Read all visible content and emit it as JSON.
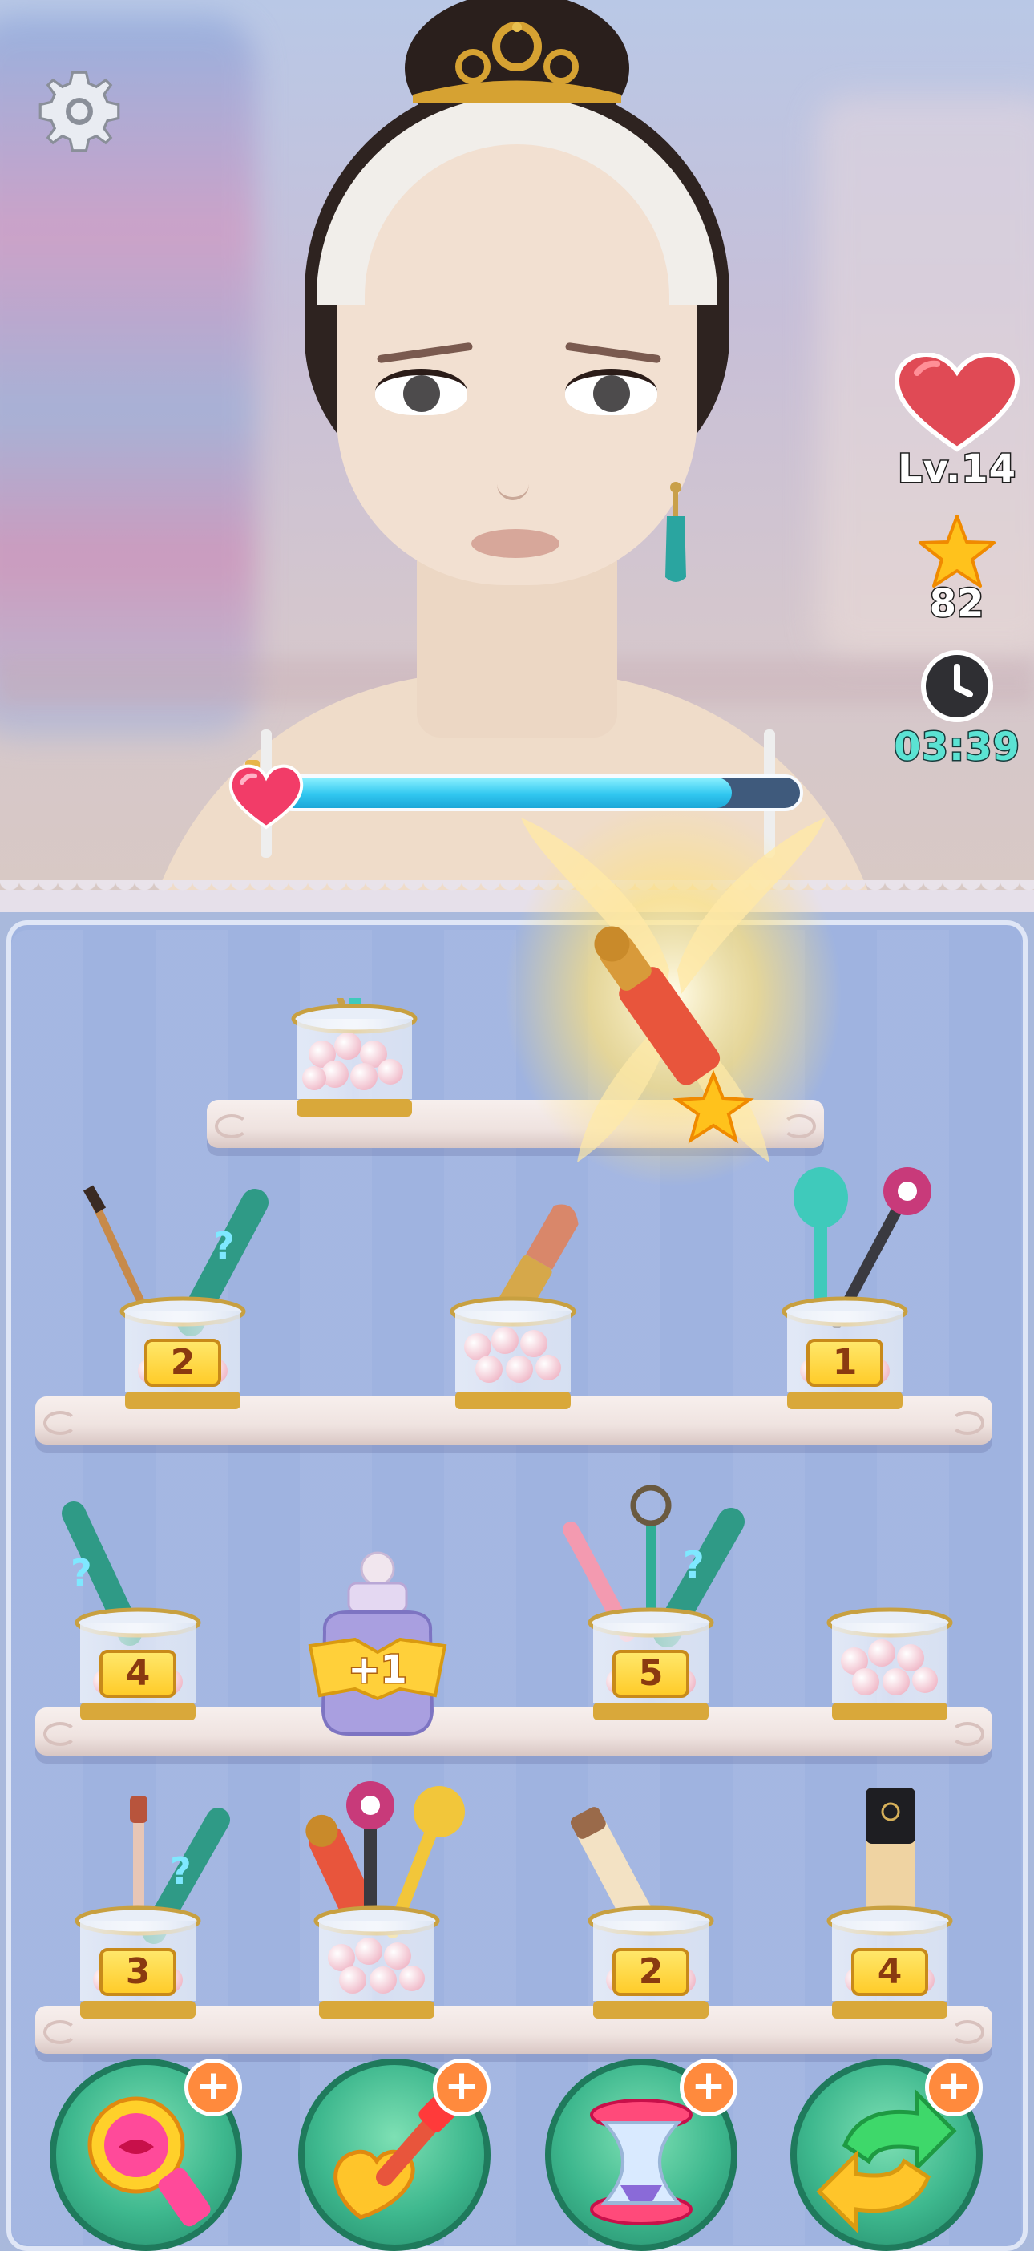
{
  "hud": {
    "level_label": "Lv.14",
    "stars": "82",
    "timer": "03:39",
    "progress_fraction": 0.87
  },
  "board": {
    "cups": [
      {
        "id": "top-cup",
        "count": ""
      },
      {
        "id": "row2-left",
        "count": "2"
      },
      {
        "id": "row2-mid",
        "count": ""
      },
      {
        "id": "row2-right",
        "count": "1"
      },
      {
        "id": "row3-a",
        "count": "4"
      },
      {
        "id": "row3-c",
        "count": "5"
      },
      {
        "id": "row3-d",
        "count": ""
      },
      {
        "id": "row4-a",
        "count": "3"
      },
      {
        "id": "row4-b",
        "count": ""
      },
      {
        "id": "row4-c",
        "count": "2"
      },
      {
        "id": "row4-d",
        "count": "4"
      }
    ],
    "bonus_jar_label": "+1"
  },
  "boosters": [
    {
      "name": "lip-booster",
      "plus": "+"
    },
    {
      "name": "brush-booster",
      "plus": "+"
    },
    {
      "name": "hourglass-booster",
      "plus": "+"
    },
    {
      "name": "swap-booster",
      "plus": "+"
    }
  ],
  "icons": {
    "settings": "gear-icon",
    "heart": "heart-icon",
    "star": "star-icon",
    "clock": "clock-icon"
  },
  "colors": {
    "timer": "#5be3d3",
    "heart": "#e04a55",
    "star": "#ffc21c",
    "progress": "#31c7f0",
    "booster": "#3eb88e",
    "plus": "#ff8a3d"
  }
}
